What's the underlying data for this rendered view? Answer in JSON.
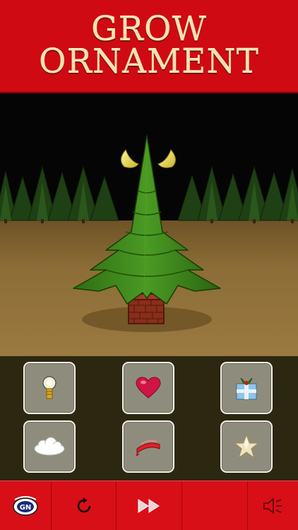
{
  "header": {
    "title_line1": "GROW",
    "title_line2": "ORNAMENT"
  },
  "scene": {
    "ground_color": "#8a6a34",
    "tree_color": "#3f8a1e",
    "horn_color": "#e8e060",
    "pot": "brick-chimney-pot"
  },
  "items": [
    {
      "name": "lightbulb",
      "icon": "lightbulb-icon"
    },
    {
      "name": "heart",
      "icon": "heart-icon"
    },
    {
      "name": "gift",
      "icon": "gift-icon"
    },
    {
      "name": "cloud",
      "icon": "cloud-icon"
    },
    {
      "name": "ribbon",
      "icon": "ribbon-icon"
    },
    {
      "name": "star",
      "icon": "star-icon"
    }
  ],
  "toolbar": {
    "buttons": [
      "logo-icon",
      "restart-icon",
      "fast-forward-icon",
      "empty",
      "speaker-icon"
    ]
  },
  "colors": {
    "header_red": "#cf0a12",
    "title_cream": "#f3e2b4",
    "panel_dark": "#2b2711",
    "button_gray": "#8e8d7d",
    "toolbar_red": "#d90f18"
  }
}
